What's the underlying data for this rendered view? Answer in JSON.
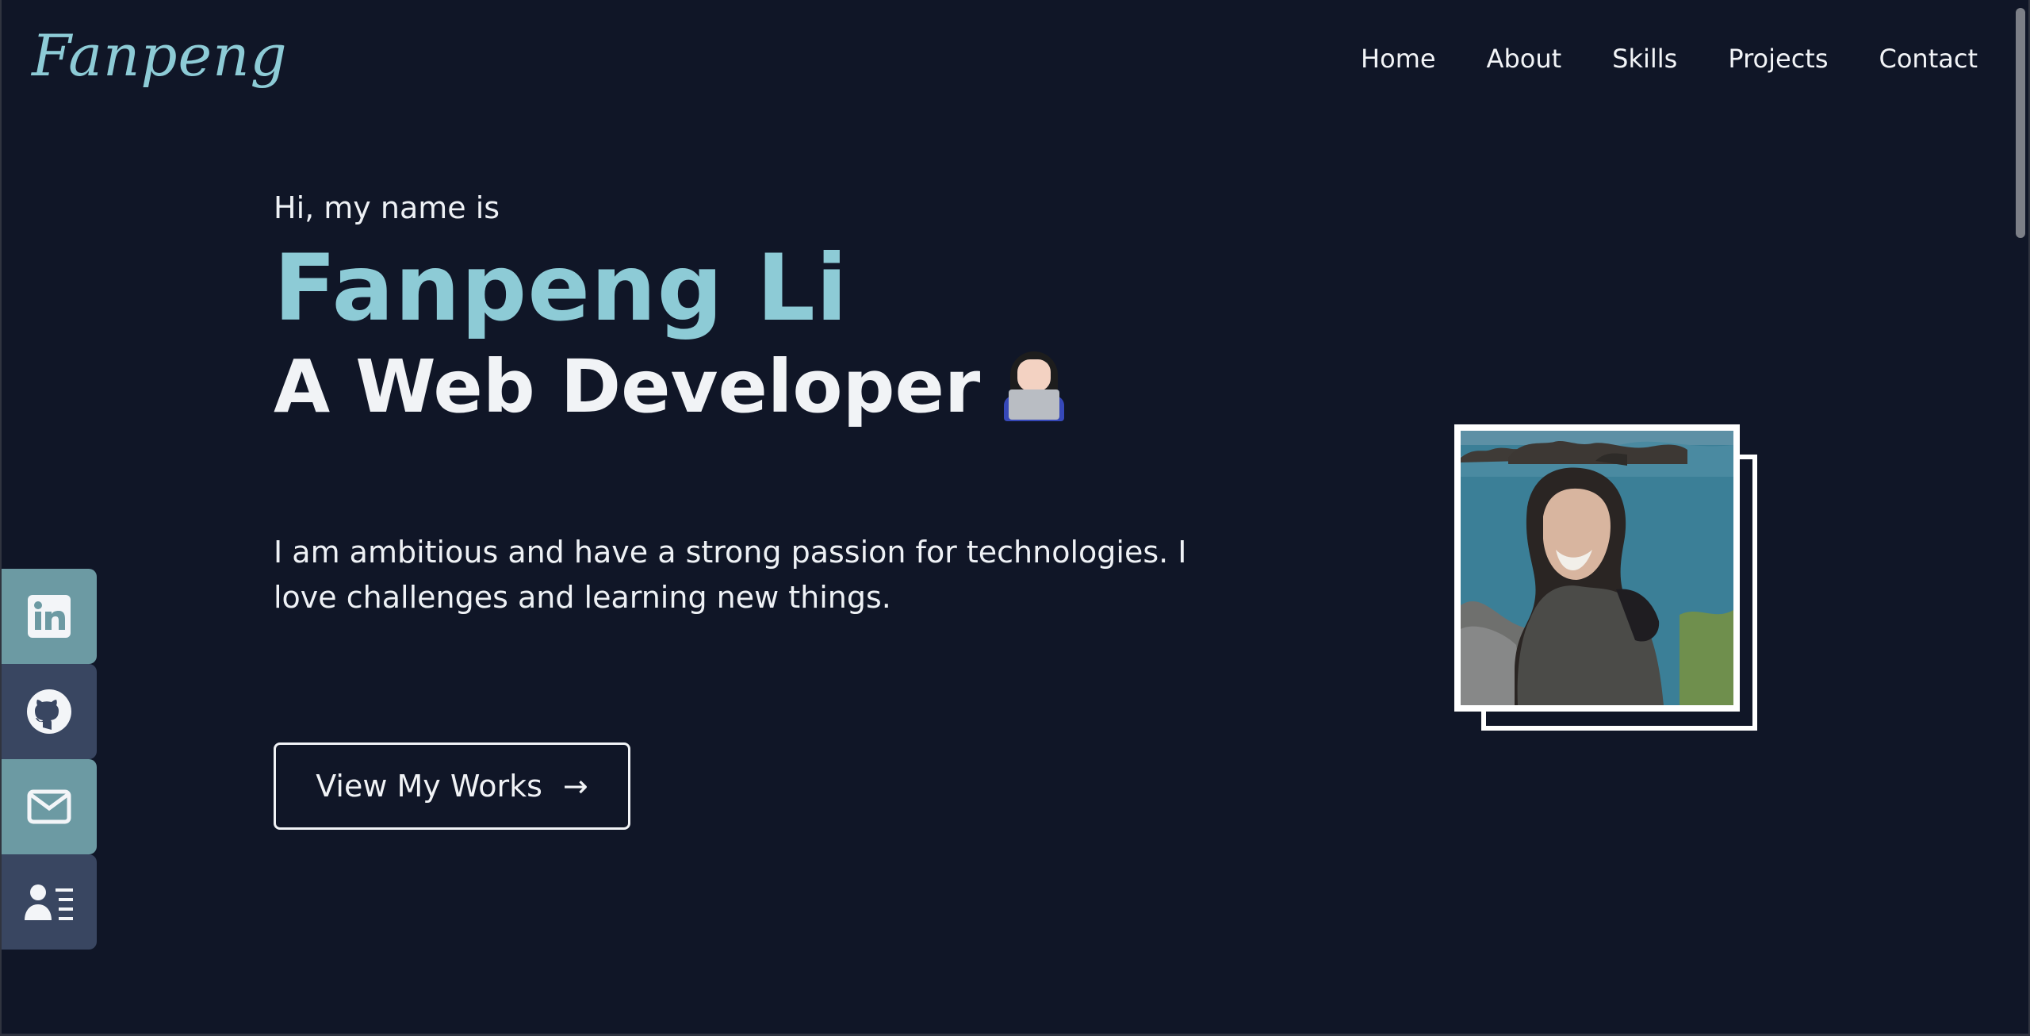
{
  "logo": {
    "text": "Fanpeng"
  },
  "nav": {
    "items": [
      {
        "label": "Home"
      },
      {
        "label": "About"
      },
      {
        "label": "Skills"
      },
      {
        "label": "Projects"
      },
      {
        "label": "Contact"
      }
    ]
  },
  "hero": {
    "intro": "Hi, my name is",
    "name": "Fanpeng Li",
    "role": "A Web Developer",
    "description": "I am ambitious and have a strong passion for technologies. I love challenges and learning new things.",
    "cta_label": "View My Works",
    "cta_arrow": "→"
  },
  "socials": [
    {
      "icon": "linkedin-icon"
    },
    {
      "icon": "github-icon"
    },
    {
      "icon": "mail-icon"
    },
    {
      "icon": "contact-card-icon"
    }
  ],
  "colors": {
    "background": "#101627",
    "accent": "#8dcbd6",
    "social_teal": "#6c9aa3",
    "social_slate": "#394661",
    "text": "#f1f3f6"
  }
}
